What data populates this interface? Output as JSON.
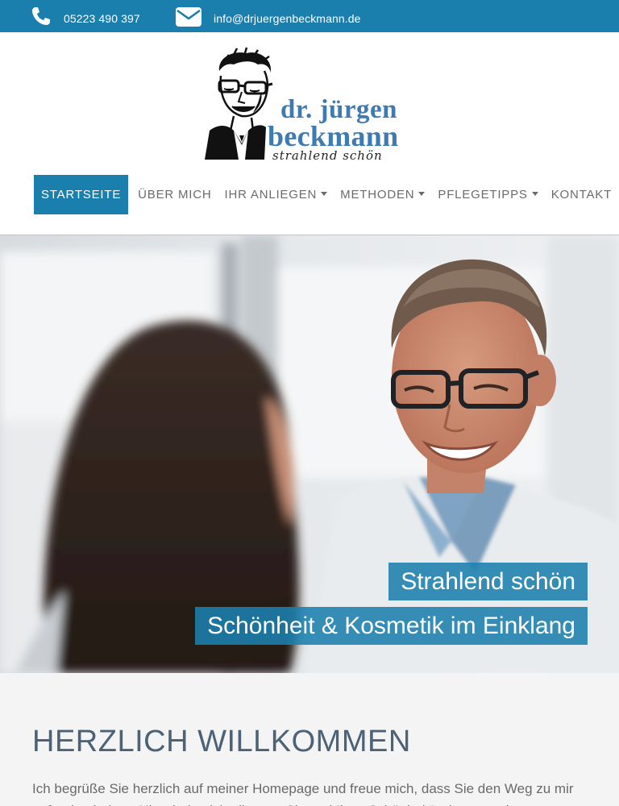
{
  "topbar": {
    "phone_icon": "phone-icon",
    "phone": "05223 490 397",
    "mail_icon": "envelope-icon",
    "email": "info@drjuergenbeckmann.de"
  },
  "logo": {
    "line1": "dr. jürgen",
    "line2": "beckmann",
    "tagline": "strahlend schön"
  },
  "nav": {
    "items": [
      {
        "label": "STARTSEITE",
        "active": true,
        "dropdown": false
      },
      {
        "label": "ÜBER MICH",
        "active": false,
        "dropdown": false
      },
      {
        "label": "IHR ANLIEGEN",
        "active": false,
        "dropdown": true
      },
      {
        "label": "METHODEN",
        "active": false,
        "dropdown": true
      },
      {
        "label": "PFLEGETIPPS",
        "active": false,
        "dropdown": true
      },
      {
        "label": "KONTAKT",
        "active": false,
        "dropdown": false
      }
    ]
  },
  "hero": {
    "caption1": "Strahlend schön",
    "caption2": "Schönheit & Kosmetik im Einklang"
  },
  "welcome": {
    "heading": "HERZLICH WILLKOMMEN",
    "text": "Ich begrüße Sie herzlich auf meiner Homepage und freue mich, dass Sie den Weg zu mir gefunden haben. Hier dreht sich alles um Sie und Ihre „Schönheit“ mit vorrangig"
  },
  "colors": {
    "brand_blue": "#1b7fae",
    "logo_blue": "#3f7ab0",
    "heading": "#4b6277"
  }
}
